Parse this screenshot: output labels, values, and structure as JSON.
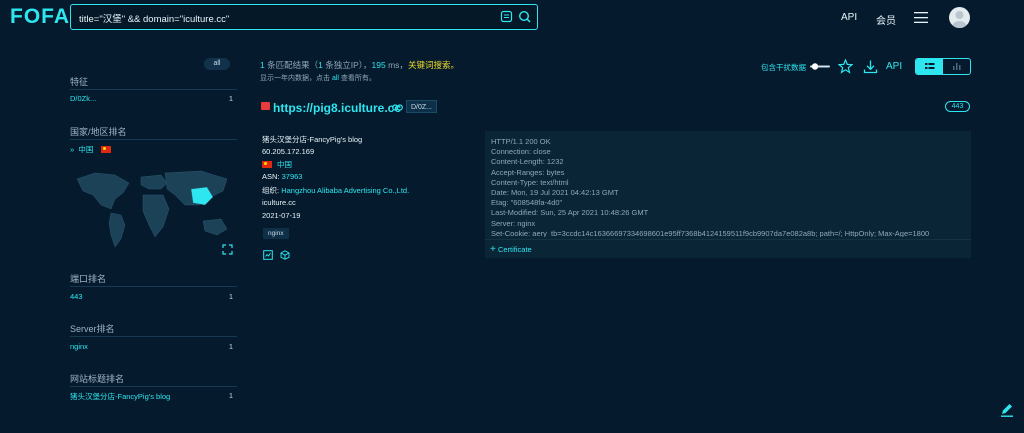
{
  "header": {
    "logo": "FOFA",
    "query": "title=\"汉堡\" && domain=\"iculture.cc\"",
    "nav_api": "API",
    "nav_member": "会员"
  },
  "sidebar": {
    "all_label": "all",
    "sections": [
      {
        "title": "特征",
        "items": [
          {
            "label": "D/0Zk...",
            "count": "1"
          }
        ]
      },
      {
        "title": "国家/地区排名",
        "items": [
          {
            "label": "中国",
            "count": ""
          }
        ]
      },
      {
        "title": "端口排名",
        "items": [
          {
            "label": "443",
            "count": "1"
          }
        ]
      },
      {
        "title": "Server排名",
        "items": [
          {
            "label": "nginx",
            "count": "1"
          }
        ]
      },
      {
        "title": "网站标题排名",
        "items": [
          {
            "label": "猪头汉堡分店-FancyPig's blog",
            "count": "1"
          }
        ]
      }
    ]
  },
  "summary": {
    "count": "1",
    "count_suffix": "条匹配结果（",
    "ip_count": "1",
    "ip_suffix": "条独立IP），",
    "time": "195",
    "time_suffix": "ms，",
    "keyword_search": "关键词搜索。",
    "sub_prefix": "显示一年内数据，点击",
    "sub_all": "all",
    "sub_suffix": "查看所有。"
  },
  "toolbar": {
    "include_label": "包含干扰数据",
    "api_label": "API"
  },
  "result": {
    "link": "https://pig8.iculture.cc",
    "tag": "D/0Z...",
    "port": "443",
    "title": "猪头汉堡分店-FancyPig's blog",
    "ip": "60.205.172.169",
    "country": "中国",
    "asn_label": "ASN:",
    "asn": "37963",
    "org_label": "组织:",
    "org": "Hangzhou Alibaba Advertising Co.,Ltd.",
    "domain": "iculture.cc",
    "date": "2021-07-19",
    "server_tag": "nginx",
    "http_lines": [
      "HTTP/1.1 200 OK",
      "Connection: close",
      "Content-Length: 1232",
      "Accept-Ranges: bytes",
      "Content-Type: text/html",
      "Date: Mon, 19 Jul 2021 04:42:13 GMT",
      "Etag: \"608548fa-4d0\"",
      "Last-Modified: Sun, 25 Apr 2021 10:48:26 GMT",
      "Server: nginx",
      "Set-Cookie: aery_tb=3ccdc14c16366697334698601e95ff7368b4124159511f9cb9907da7e082a8b; path=/; HttpOnly; Max-Age=1800"
    ],
    "certificate_label": "Certificate"
  }
}
